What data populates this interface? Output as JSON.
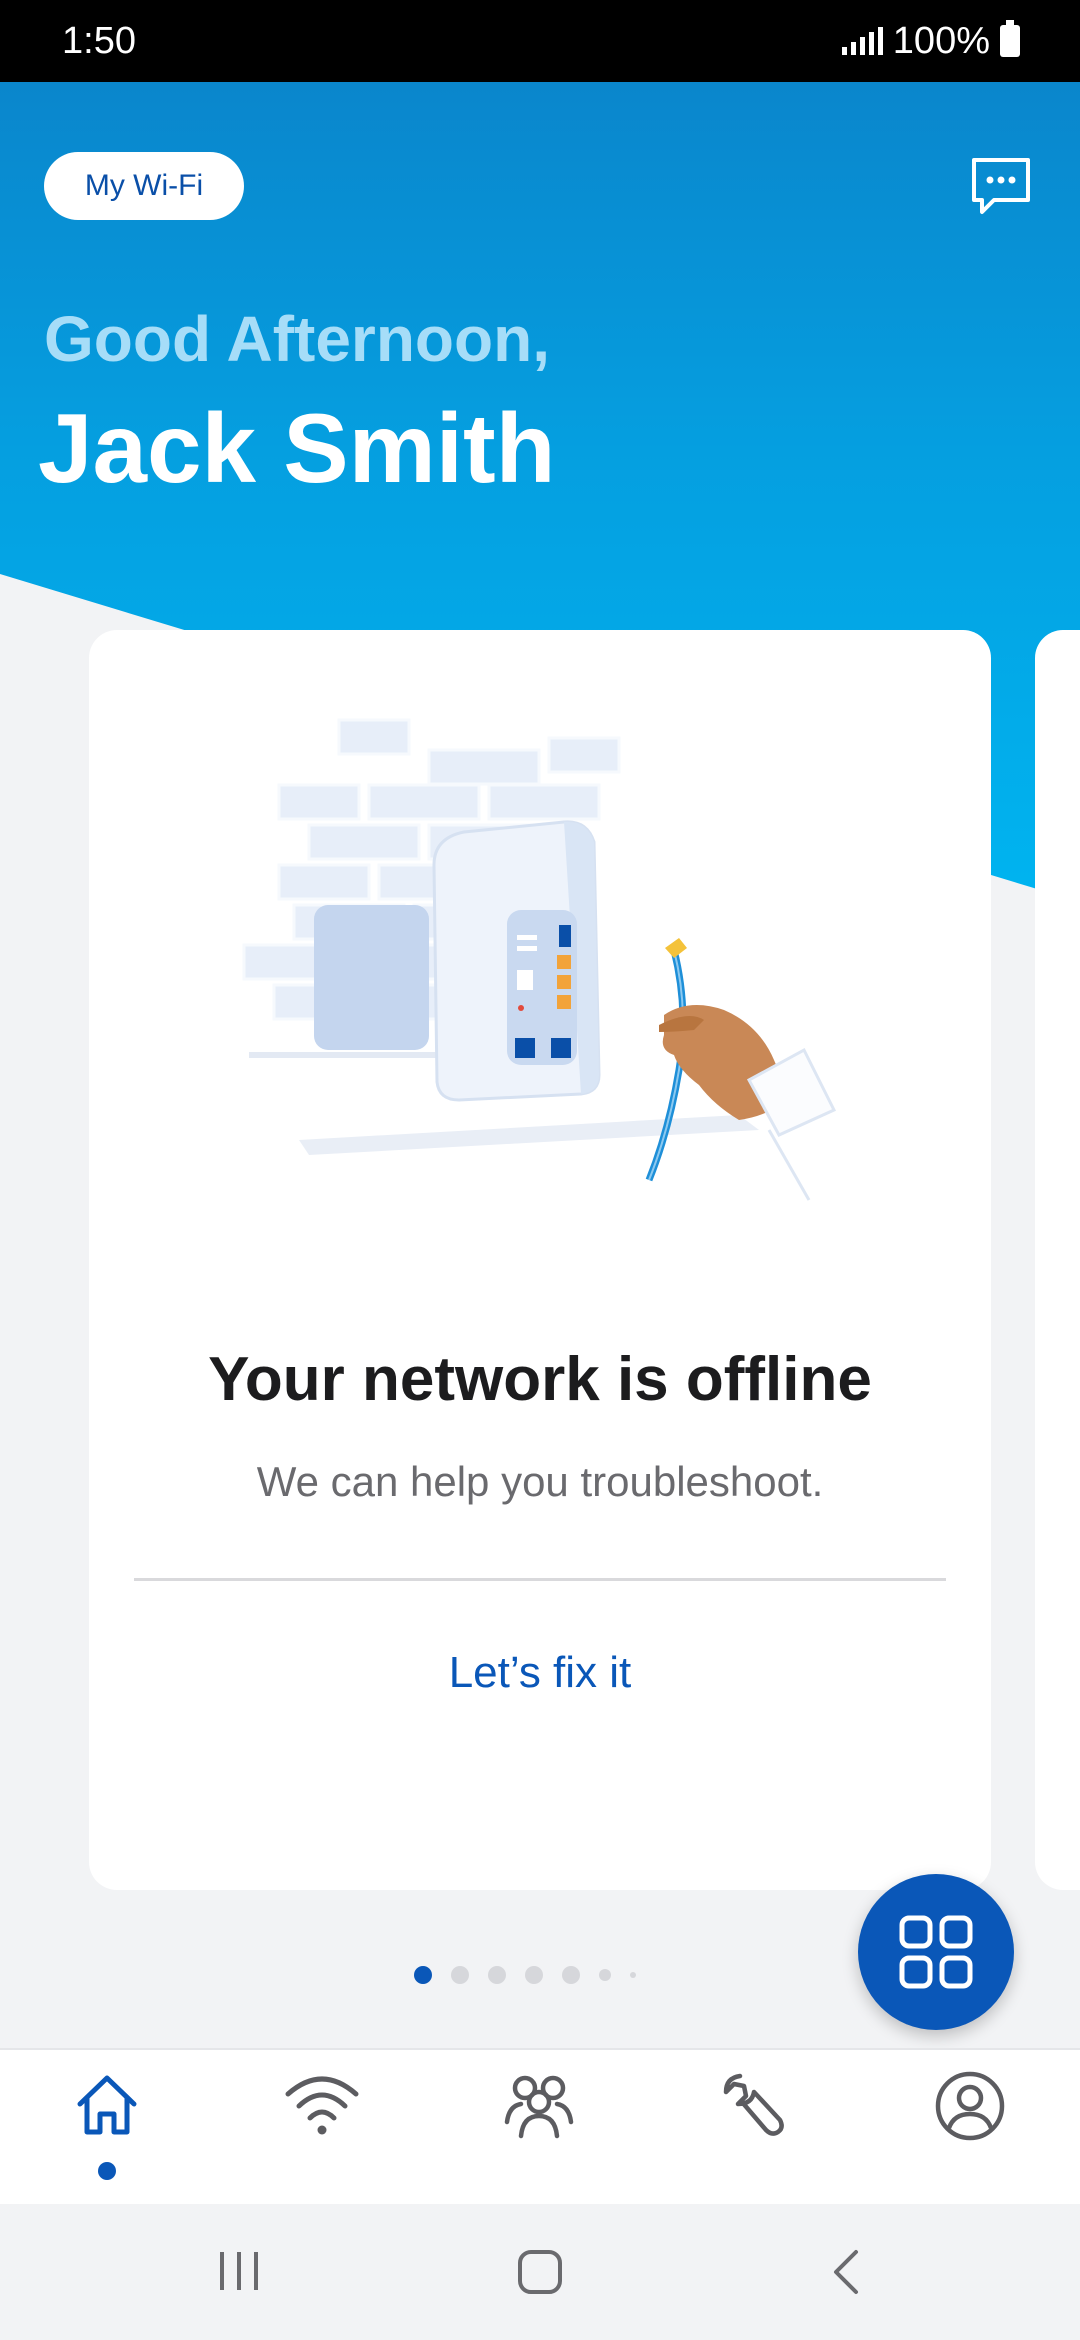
{
  "status_bar": {
    "time": "1:50",
    "battery": "100%"
  },
  "header": {
    "wifi_pill_label": "My Wi-Fi",
    "greeting": "Good Afternoon,",
    "user_name": "Jack Smith"
  },
  "card": {
    "title": "Your network is offline",
    "subtitle": "We can help you troubleshoot.",
    "action_label": "Let’s fix it"
  },
  "carousel": {
    "page_count": 7,
    "active_index": 0
  },
  "bottom_nav": {
    "items": [
      {
        "icon": "home-icon",
        "active": true
      },
      {
        "icon": "wifi-icon",
        "active": false
      },
      {
        "icon": "people-icon",
        "active": false
      },
      {
        "icon": "wrench-icon",
        "active": false
      },
      {
        "icon": "account-icon",
        "active": false
      }
    ]
  },
  "colors": {
    "brand_blue": "#0a57b8",
    "hero_top": "#0a86cc",
    "hero_bottom": "#00b4f0",
    "greeting_color": "#a6ddf8"
  }
}
